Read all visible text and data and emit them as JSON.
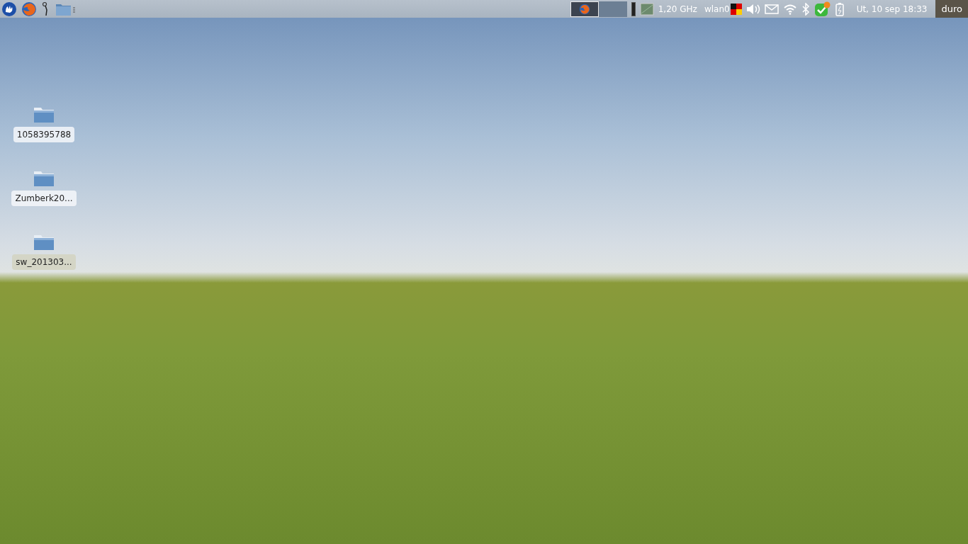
{
  "panel": {
    "tasks": [
      {
        "selected": true
      }
    ],
    "cpu_frequency": "1,20 GHz",
    "network_interface": "wlan0",
    "clock": "Ut, 10 sep  18:33",
    "user": "duro"
  },
  "desktop_icons": [
    {
      "label": "1058395788",
      "selected": false
    },
    {
      "label": "Zumberk20...",
      "selected": false
    },
    {
      "label": "sw_201303...",
      "selected": true
    }
  ]
}
